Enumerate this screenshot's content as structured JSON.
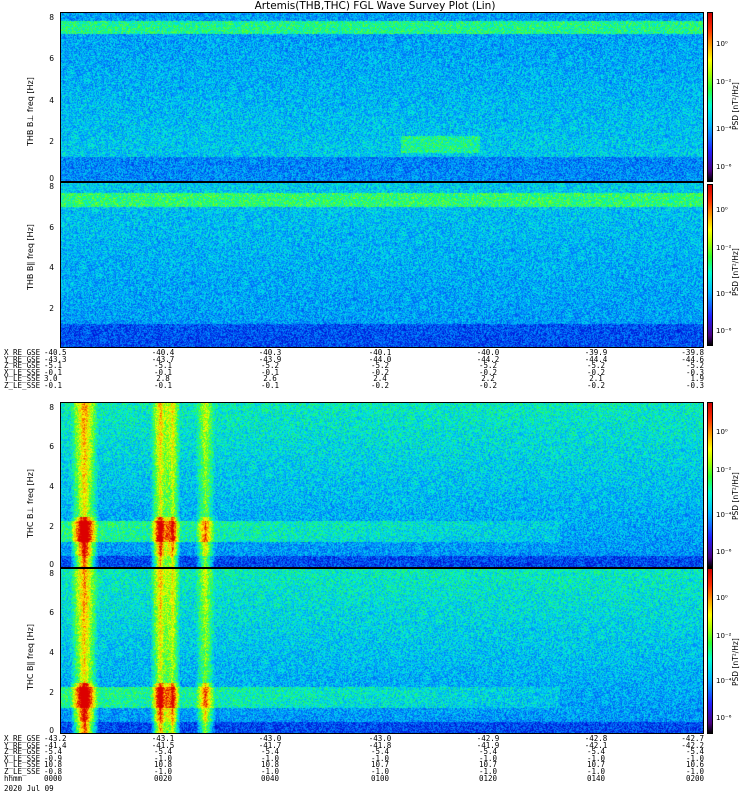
{
  "title": "Artemis(THB,THC) FGL Wave Survey Plot (Lin)",
  "colorbar": {
    "label": "PSD [nT²/Hz]",
    "ticks": [
      "10⁰",
      "10⁻²",
      "10⁻⁴",
      "10⁻⁶"
    ]
  },
  "chart_data": [
    {
      "type": "heatmap",
      "ylabel": "THB B⊥ freq [Hz]",
      "y_axis_label": "THB B⊥\nfreq [Hz]",
      "ytick_labels": [
        "8",
        "6",
        "4",
        "2",
        "0"
      ],
      "ylim": [
        0,
        8
      ],
      "colorbar_label": "PSD [nT²/Hz]",
      "colorbar_ticks": [
        "10⁰",
        "10⁻²",
        "10⁻⁴",
        "10⁻⁶"
      ],
      "features": "background emission below 1 Hz; weak band near 1.5-2 Hz around 0040-0120; enhanced band near 7-7.5 Hz"
    },
    {
      "type": "heatmap",
      "ylabel": "THB B∥ freq [Hz]",
      "y_axis_label": "THB B∥\nfreq [Hz]",
      "ytick_labels": [
        "8",
        "6",
        "4",
        "2",
        "0"
      ],
      "ylim": [
        0,
        8
      ],
      "colorbar_label": "PSD [nT²/Hz]",
      "colorbar_ticks": [
        "10⁰",
        "10⁻²",
        "10⁻⁴",
        "10⁻⁶"
      ],
      "features": "low PSD throughout; enhanced band near 7 Hz"
    },
    {
      "type": "heatmap",
      "ylabel": "THC B⊥ freq [Hz]",
      "y_axis_label": "THC B⊥\nfreq [Hz]",
      "ytick_labels": [
        "8",
        "6",
        "4",
        "2",
        "0"
      ],
      "ylim": [
        0,
        8
      ],
      "colorbar_label": "PSD [nT²/Hz]",
      "colorbar_ticks": [
        "10⁰",
        "10⁻⁶",
        "10⁻⁴",
        "10⁻⁶"
      ],
      "features": "strong emissions ~1.5-2 Hz at 0000-0030 with broadband bursts; band continues to ~0130"
    },
    {
      "type": "heatmap",
      "ylabel": "THC B∥ freq [Hz]",
      "y_axis_label": "THC B∥\nfreq [Hz]",
      "ytick_labels": [
        "8",
        "6",
        "4",
        "2",
        "0"
      ],
      "ylim": [
        0,
        8
      ],
      "colorbar_label": "PSD [nT²/Hz]",
      "colorbar_ticks": [
        "10⁰",
        "10⁻²",
        "10⁻⁴",
        "10⁻⁶"
      ],
      "features": "broadband bursts near 0005 and 0020; band near 1.5-2 Hz"
    }
  ],
  "ephemeris_thb": {
    "rows": [
      {
        "name": "X_RE_GSE",
        "values": [
          "-40.5",
          "-40.4",
          "-40.3",
          "-40.1",
          "-40.0",
          "-39.9",
          "-39.8"
        ]
      },
      {
        "name": "Y_RE_GSE",
        "values": [
          "-43.3",
          "-43.7",
          "-43.9",
          "-44.0",
          "-44.2",
          "-44.4",
          "-44.6"
        ]
      },
      {
        "name": "Z_RE_GSE",
        "values": [
          "-5.1",
          "-5.1",
          "-5.2",
          "-5.2",
          "-5.2",
          "-5.2",
          "-5.2"
        ]
      },
      {
        "name": "X_LE_SSE",
        "values": [
          "-0.1",
          "-0.1",
          "-0.1",
          "-0.2",
          "-0.2",
          "-0.2",
          "-0.3"
        ]
      },
      {
        "name": "Y_LE_SSE",
        "values": [
          "3.0",
          "2.8",
          "2.6",
          "2.4",
          "2.2",
          "2.1",
          "1.9"
        ]
      },
      {
        "name": "Z_LE_SSE",
        "values": [
          "-0.1",
          "-0.1",
          "-0.1",
          "-0.2",
          "-0.2",
          "-0.2",
          "-0.3"
        ]
      }
    ]
  },
  "ephemeris_thc": {
    "rows": [
      {
        "name": "X_RE_GSE",
        "values": [
          "-43.2",
          "-43.1",
          "-43.0",
          "-43.0",
          "-42.9",
          "-42.8",
          "-42.7"
        ]
      },
      {
        "name": "Y_RE_GSE",
        "values": [
          "-41.4",
          "-41.5",
          "-41.7",
          "-41.8",
          "-41.9",
          "-42.1",
          "-42.2"
        ]
      },
      {
        "name": "Z_RE_GSE",
        "values": [
          "-5.4",
          "-5.4",
          "-5.4",
          "-5.4",
          "-5.4",
          "-5.4",
          "-5.4"
        ]
      },
      {
        "name": "X_LE_SSE",
        "values": [
          "-0.9",
          "-1.0",
          "-1.0",
          "-1.0",
          "-1.0",
          "-1.0",
          "-1.0"
        ]
      },
      {
        "name": "Y_LE_SSE",
        "values": [
          "10.8",
          "10.8",
          "10.8",
          "10.7",
          "10.7",
          "10.7",
          "10.6"
        ]
      },
      {
        "name": "Z_LE_SSE",
        "values": [
          "-0.8",
          "-1.0",
          "-1.0",
          "-1.0",
          "-1.0",
          "-1.0",
          "-1.0"
        ]
      },
      {
        "name": "hhmm",
        "values": [
          "0000",
          "0020",
          "0040",
          "0100",
          "0120",
          "0140",
          "0200"
        ]
      }
    ],
    "date": "2020 Jul 09"
  }
}
